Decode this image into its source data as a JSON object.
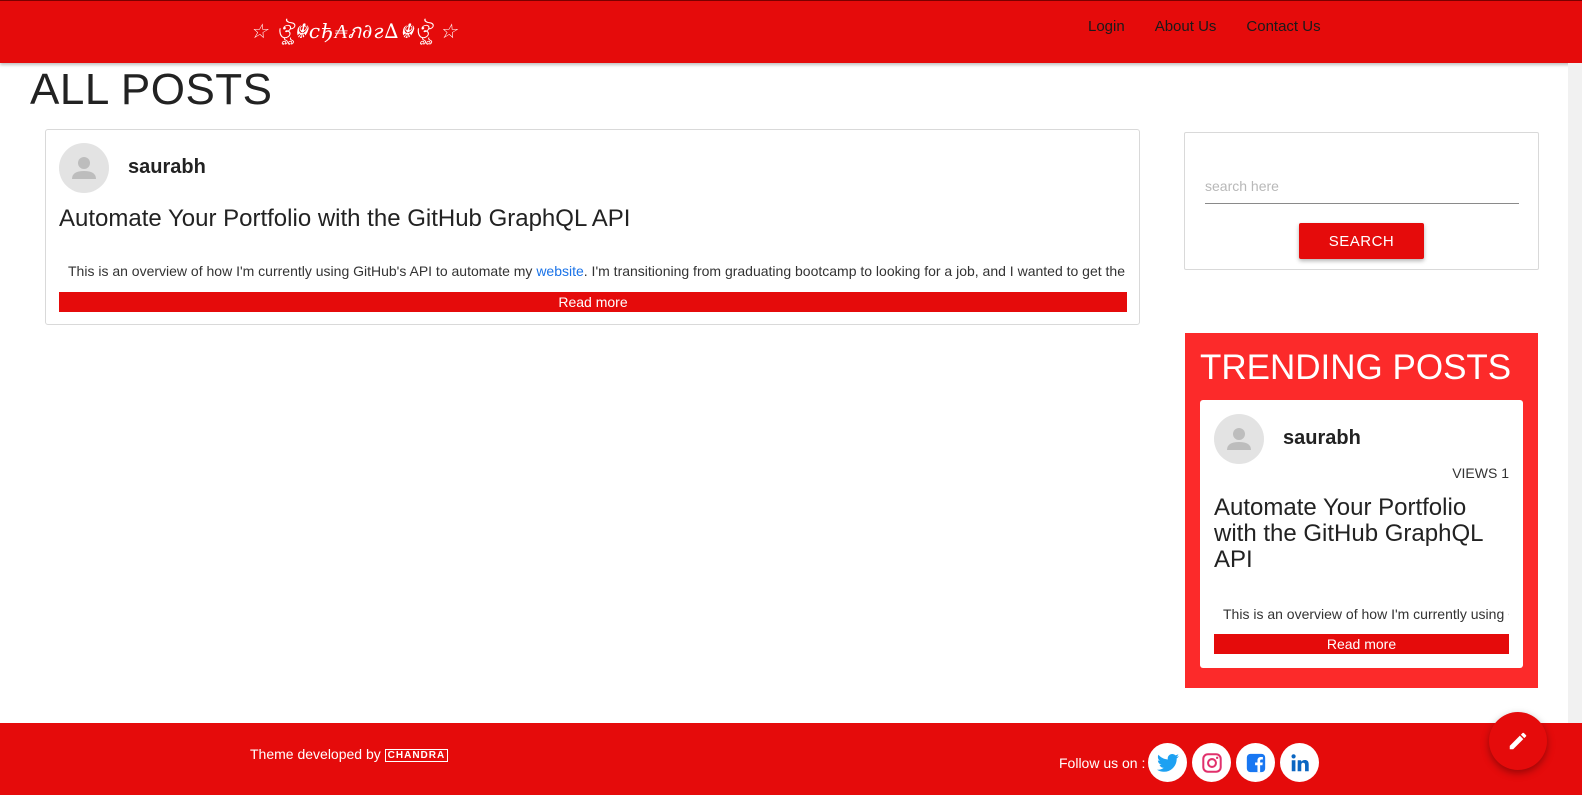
{
  "navbar": {
    "logo_text": "☆ ঔৣ☬cђ₳ภ∂г∆☬ঔৣ ☆",
    "links": [
      {
        "label": "Login"
      },
      {
        "label": "About Us"
      },
      {
        "label": "Contact Us"
      }
    ]
  },
  "page": {
    "title": "ALL POSTS"
  },
  "posts": [
    {
      "author": "saurabh",
      "title": "Automate Your Portfolio with the GitHub GraphQL API",
      "excerpt_before": "This is an overview of how I'm currently using GitHub's API to automate my ",
      "excerpt_link": "website",
      "excerpt_after": ". I'm transitioning from graduating bootcamp to looking for a job, and I wanted to get the p",
      "read_more": "Read more"
    }
  ],
  "search": {
    "placeholder": "search here",
    "button_label": "SEARCH"
  },
  "trending": {
    "title": "TRENDING POSTS",
    "items": [
      {
        "author": "saurabh",
        "views": "VIEWS 1",
        "title": "Automate Your Portfolio with the GitHub GraphQL API",
        "excerpt": "This is an overview of how I'm currently using G",
        "read_more": "Read more"
      }
    ]
  },
  "footer": {
    "credit": "Theme developed by",
    "brand": "CHANDRA",
    "follow": "Follow us on :",
    "socials": [
      {
        "icon": "twitter-icon",
        "color": "#1da1f2"
      },
      {
        "icon": "instagram-icon",
        "color": "#e1306c"
      },
      {
        "icon": "facebook-icon",
        "color": "#1877f2"
      },
      {
        "icon": "linkedin-icon",
        "color": "#0a66c2"
      }
    ]
  },
  "colors": {
    "primary_red": "#e50b0b",
    "trending_red": "#fc2a2a",
    "link_blue": "#1a73e8"
  },
  "fab": {
    "icon": "pencil-icon"
  }
}
